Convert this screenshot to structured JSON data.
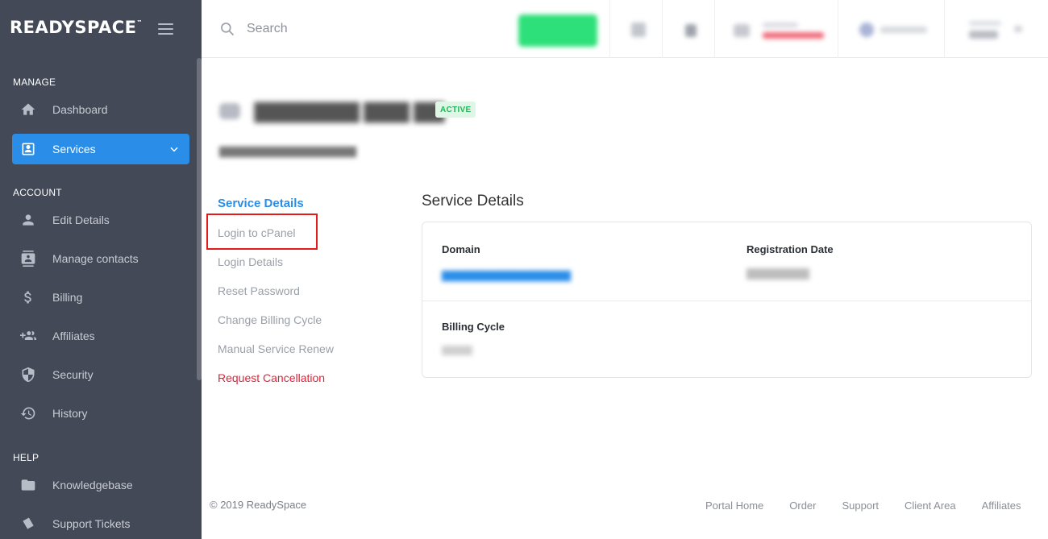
{
  "brand": {
    "name": "READYSPACE",
    "tm": "™"
  },
  "sidebar": {
    "sections": [
      {
        "label": "MANAGE"
      },
      {
        "label": "ACCOUNT"
      },
      {
        "label": "HELP"
      }
    ],
    "items": [
      {
        "label": "Dashboard",
        "icon": "home-icon"
      },
      {
        "label": "Services",
        "icon": "account-box-icon",
        "active": true
      },
      {
        "label": "Edit Details",
        "icon": "person-icon"
      },
      {
        "label": "Manage contacts",
        "icon": "contacts-icon"
      },
      {
        "label": "Billing",
        "icon": "dollar-icon"
      },
      {
        "label": "Affiliates",
        "icon": "group-add-icon"
      },
      {
        "label": "Security",
        "icon": "shield-icon"
      },
      {
        "label": "History",
        "icon": "history-icon"
      },
      {
        "label": "Knowledgebase",
        "icon": "folder-icon"
      },
      {
        "label": "Support Tickets",
        "icon": "ticket-icon"
      }
    ]
  },
  "topbar": {
    "search_placeholder": "Search"
  },
  "service": {
    "status": "ACTIVE"
  },
  "subnav": {
    "items": [
      {
        "label": "Service Details",
        "state": "active"
      },
      {
        "label": "Login to cPanel",
        "state": "highlighted"
      },
      {
        "label": "Login Details"
      },
      {
        "label": "Reset Password"
      },
      {
        "label": "Change Billing Cycle"
      },
      {
        "label": "Manual Service Renew"
      },
      {
        "label": "Request Cancellation",
        "state": "danger"
      }
    ]
  },
  "details": {
    "heading": "Service Details",
    "fields": {
      "domain_label": "Domain",
      "registration_label": "Registration Date",
      "billing_label": "Billing Cycle"
    }
  },
  "footer": {
    "copyright": "© 2019 ReadySpace",
    "links": [
      "Portal Home",
      "Order",
      "Support",
      "Client Area",
      "Affiliates"
    ]
  },
  "colors": {
    "sidebar_bg": "#434957",
    "accent": "#2a8ee8",
    "order_green": "#2ee07a",
    "danger": "#e0233a",
    "badge_bg": "#dff6e6",
    "badge_text": "#27b35a",
    "highlight_red": "#e31b1b"
  }
}
